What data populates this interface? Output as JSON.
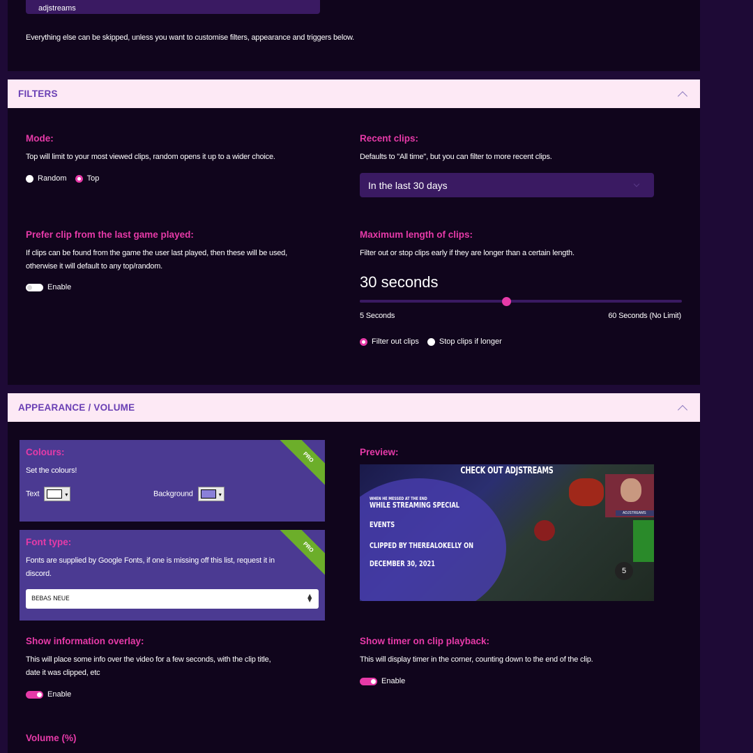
{
  "channel": {
    "value": "adjstreams"
  },
  "top_note": "Everything else can be skipped, unless you want to customise filters, appearance and triggers below.",
  "filters": {
    "title": "FILTERS",
    "mode": {
      "label": "Mode:",
      "desc": "Top will limit to your most viewed clips, random opens it up to a wider choice.",
      "options": [
        "Random",
        "Top"
      ],
      "selected": "Top"
    },
    "recent": {
      "label": "Recent clips:",
      "desc": "Defaults to \"All time\", but you can filter to more recent clips.",
      "selected": "In the last 30 days"
    },
    "prefer": {
      "label": "Prefer clip from the last game played:",
      "desc1": "If clips can be found from the game the user last played, then these will be used,",
      "desc2": "otherwise it will default to any top/random.",
      "toggle_label": "Enable",
      "enabled": false
    },
    "max_length": {
      "label": "Maximum length of clips:",
      "desc": "Filter out or stop clips early if they are longer than a certain length.",
      "value_text": "30 seconds",
      "value": 30,
      "min": 5,
      "max": 60,
      "min_label": "5 Seconds",
      "max_label": "60 Seconds (No Limit)",
      "options": [
        "Filter out clips",
        "Stop clips if longer"
      ],
      "selected": "Filter out clips"
    }
  },
  "appearance": {
    "title": "APPEARANCE / VOLUME",
    "colours": {
      "label": "Colours:",
      "desc": "Set the colours!",
      "text_label": "Text",
      "text_color": "#ffffff",
      "bg_label": "Background",
      "bg_color": "#8a80d8",
      "badge": "PRO"
    },
    "font": {
      "label": "Font type:",
      "desc1": "Fonts are supplied by Google Fonts, if one is missing off this list, request it in",
      "desc2": "discord.",
      "selected": "BEBAS NEUE",
      "badge": "PRO"
    },
    "preview": {
      "label": "Preview:",
      "headline": "CHECK OUT ADJSTREAMS",
      "tiny": "WHEN HE MESSED AT THE END",
      "line1": "WHILE STREAMING SPECIAL",
      "line2": "EVENTS",
      "line3": "CLIPPED BY THEREALOKELLY ON",
      "line4": "DECEMBER 30, 2021",
      "timer": "5",
      "tag": "ADJSTREAMS"
    },
    "overlay": {
      "label": "Show information overlay:",
      "desc1": "This will place some info over the video for a few seconds, with the clip title,",
      "desc2": "date it was clipped, etc",
      "toggle_label": "Enable",
      "enabled": true
    },
    "timer": {
      "label": "Show timer on clip playback:",
      "desc": "This will display timer in the corner, counting down to the end of the clip.",
      "toggle_label": "Enable",
      "enabled": true
    },
    "volume": {
      "label": "Volume (%)"
    }
  },
  "colors": {
    "accent": "#e63aa8",
    "header_bg": "#fde9f5",
    "panel_bg": "#10051c",
    "page_bg": "#1e0a36",
    "pro_card": "#4b3a92",
    "ribbon": "#6cae2a"
  }
}
